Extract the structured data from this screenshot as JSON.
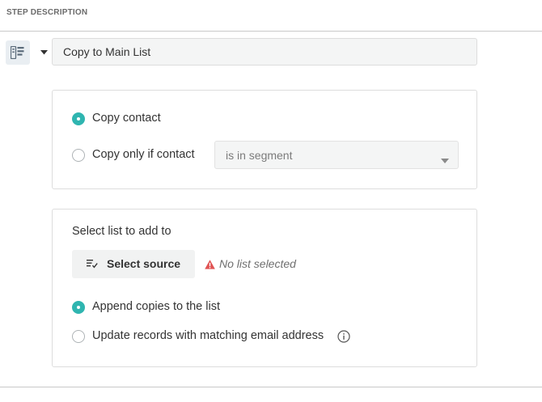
{
  "section": {
    "title": "STEP DESCRIPTION"
  },
  "step": {
    "name_value": "Copy to Main List",
    "icon": "step-list-icon"
  },
  "copy_options": {
    "option_all_label": "Copy contact",
    "option_all_checked": true,
    "option_conditional_label": "Copy only if contact",
    "option_conditional_checked": false,
    "condition_select_value": "is in segment"
  },
  "destination": {
    "heading": "Select list to add to",
    "select_source_label": "Select source",
    "warning_text": "No list selected",
    "append_label": "Append copies to the list",
    "append_checked": true,
    "update_label": "Update records with matching email address",
    "update_checked": false
  },
  "colors": {
    "accent": "#2fb5b0",
    "warning": "#e05353",
    "icon_bg": "#e9eef2",
    "input_bg": "#f4f5f5"
  },
  "icons": [
    "step-list-icon",
    "caret-down-icon",
    "chevron-down-icon",
    "list-select-icon",
    "warning-icon",
    "info-icon"
  ]
}
